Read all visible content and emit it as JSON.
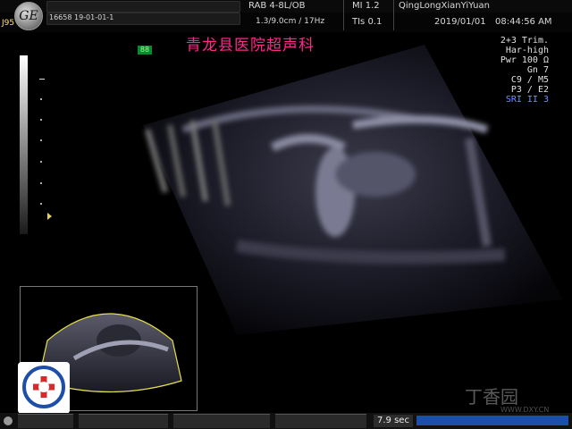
{
  "header": {
    "probe_code": "J95",
    "patient_id": "16658 19-01-01-1",
    "preset": "RAB 4-8L/OB",
    "depth_fps": "1.3/9.0cm / 17Hz",
    "mi": "MI  1.2",
    "tis": "TIs  0.1",
    "institution": "QingLongXianYiYuan",
    "date": "2019/01/01",
    "time": "08:44:56 AM"
  },
  "watermark": {
    "hospital_title": "青龙县医院超声科",
    "green_tag": "88"
  },
  "params": {
    "line1": "2+3 Trim.",
    "line2": "Har-high",
    "line3": "Pwr 100 Ω",
    "line4": "Gn   7",
    "line5": "C9 / M5",
    "line6": "P3 / E2",
    "line7": "SRI II 3"
  },
  "footer": {
    "cine_time": "7.9 sec"
  },
  "site_watermark": {
    "name": "丁香园",
    "url": "WWW.DXY.CN"
  },
  "colors": {
    "title_pink": "#ff2a8a",
    "accent_blue": "#7090ff",
    "timebar_blue": "#1b4fa8"
  }
}
